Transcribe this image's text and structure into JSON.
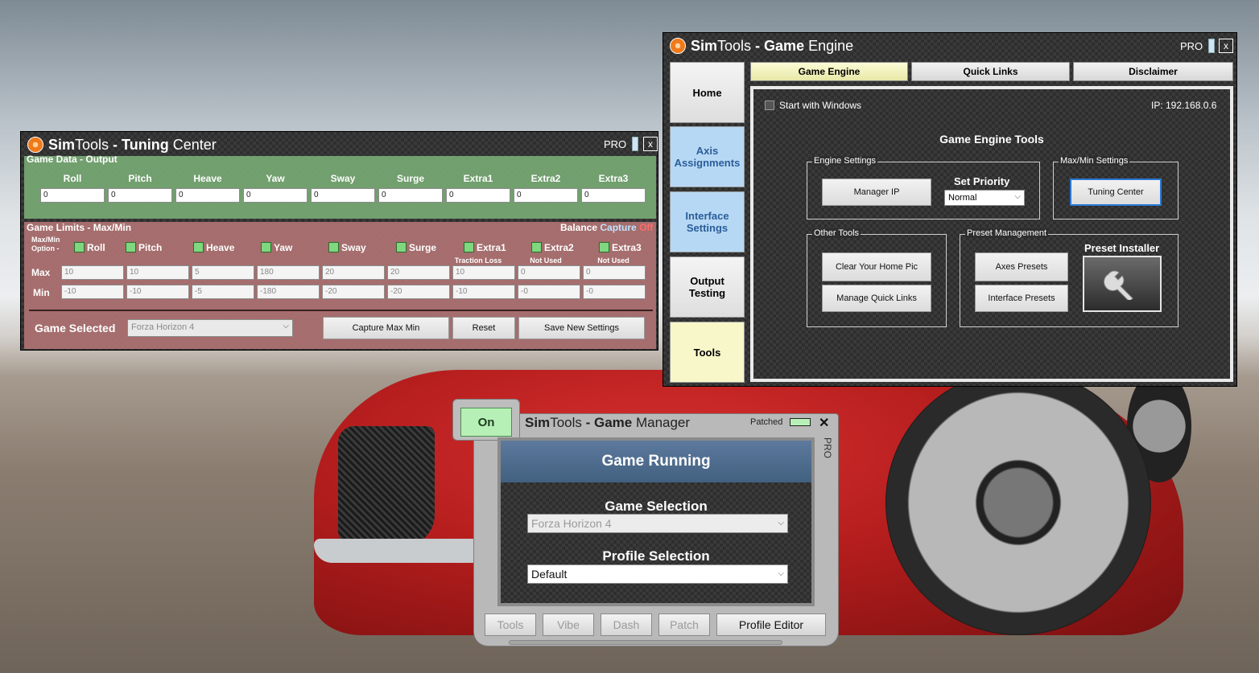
{
  "tuning_center": {
    "title_sim": "Sim",
    "title_tools": "Tools",
    "title_dash": " - ",
    "title_tuning": "Tuning",
    "title_center": " Center",
    "pro": "PRO",
    "close": "x",
    "game_data_label": "Game Data - Output",
    "axes": [
      "Roll",
      "Pitch",
      "Heave",
      "Yaw",
      "Sway",
      "Surge",
      "Extra1",
      "Extra2",
      "Extra3"
    ],
    "output_values": [
      "0",
      "0",
      "0",
      "0",
      "0",
      "0",
      "0",
      "0",
      "0"
    ],
    "game_limits_label": "Game Limits - Max/Min",
    "balance_label": "Balance",
    "capture_label": "Capture",
    "capture_state": "Off",
    "maxmin_option": "Max/Min Option -",
    "sublabels": [
      "",
      "",
      "",
      "",
      "",
      "",
      "Traction Loss",
      "Not Used",
      "Not Used"
    ],
    "max_label": "Max",
    "min_label": "Min",
    "max_values": [
      "10",
      "10",
      "5",
      "180",
      "20",
      "20",
      "10",
      "0",
      "0"
    ],
    "min_values": [
      "-10",
      "-10",
      "-5",
      "-180",
      "-20",
      "-20",
      "-10",
      "-0",
      "-0"
    ],
    "game_selected_label": "Game Selected",
    "game_selected_value": "Forza Horizon 4",
    "capture_btn": "Capture Max Min",
    "reset_btn": "Reset",
    "save_btn": "Save New Settings"
  },
  "game_engine": {
    "title_sim": "Sim",
    "title_tools": "Tools",
    "title_dash": " - ",
    "title_game": "Game",
    "title_engine": " Engine",
    "pro": "PRO",
    "close": "x",
    "sidebar": [
      "Home",
      "Axis Assignments",
      "Interface Settings",
      "Output Testing",
      "Tools"
    ],
    "tabs": [
      "Game Engine",
      "Quick Links",
      "Disclaimer"
    ],
    "start_with_windows": "Start with Windows",
    "ip": "IP: 192.168.0.6",
    "tools_heading": "Game Engine Tools",
    "engine_settings": "Engine Settings",
    "manager_ip_btn": "Manager IP",
    "set_priority": "Set Priority",
    "priority_value": "Normal",
    "maxmin_settings": "Max/Min Settings",
    "tuning_center_btn": "Tuning Center",
    "other_tools": "Other Tools",
    "clear_home_btn": "Clear Your Home Pic",
    "manage_links_btn": "Manage Quick Links",
    "preset_management": "Preset Management",
    "axes_presets_btn": "Axes Presets",
    "interface_presets_btn": "Interface Presets",
    "preset_installer": "Preset Installer"
  },
  "game_manager": {
    "on_btn": "On",
    "title_sim": "Sim",
    "title_tools": "Tools",
    "title_dash": " - ",
    "title_game": "Game",
    "title_manager": " Manager",
    "patched": "Patched",
    "close": "✕",
    "pro_vertical": "PRO",
    "status": "Game Running",
    "game_selection_label": "Game Selection",
    "game_selection_value": "Forza Horizon 4",
    "profile_selection_label": "Profile Selection",
    "profile_selection_value": "Default",
    "bottom_buttons": [
      "Tools",
      "Vibe",
      "Dash",
      "Patch",
      "Profile Editor"
    ]
  }
}
